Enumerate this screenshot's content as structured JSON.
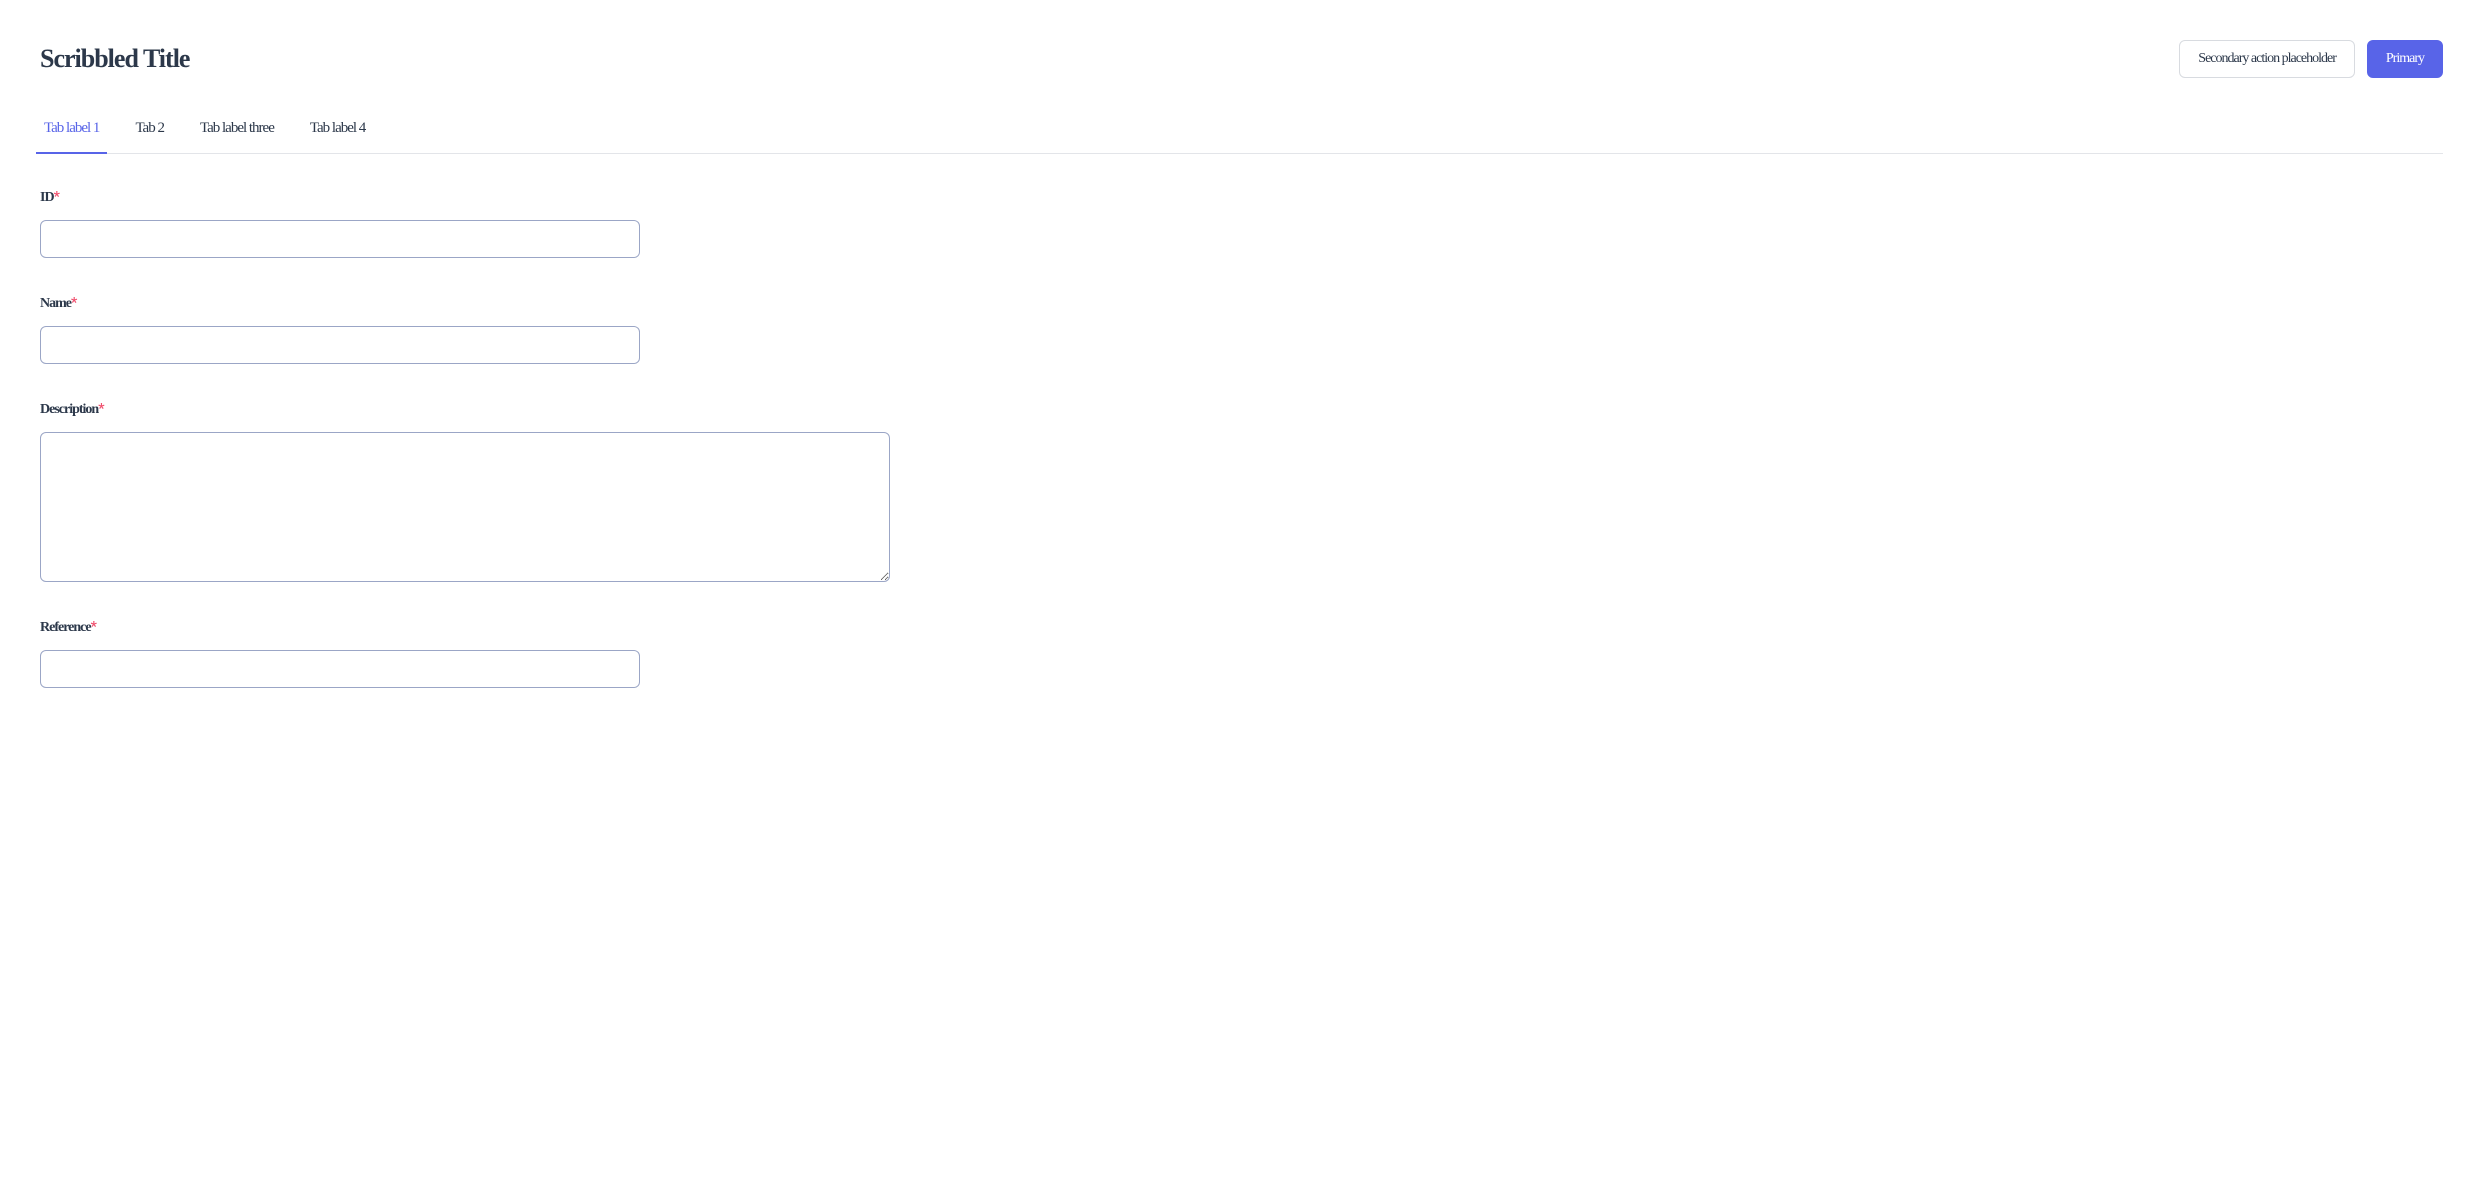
{
  "header": {
    "title": "Scribbled Title",
    "secondary_button": "Secondary action placeholder",
    "primary_button": "Primary"
  },
  "tabs": [
    {
      "label": "Tab label 1",
      "active": true
    },
    {
      "label": "Tab 2",
      "active": false
    },
    {
      "label": "Tab label three",
      "active": false
    },
    {
      "label": "Tab label 4",
      "active": false
    }
  ],
  "fields": [
    {
      "label": "ID",
      "type": "input",
      "required": true
    },
    {
      "label": "Name",
      "type": "input",
      "required": true
    },
    {
      "label": "Description",
      "type": "textarea",
      "required": true
    },
    {
      "label": "Reference",
      "type": "input",
      "required": true
    }
  ]
}
